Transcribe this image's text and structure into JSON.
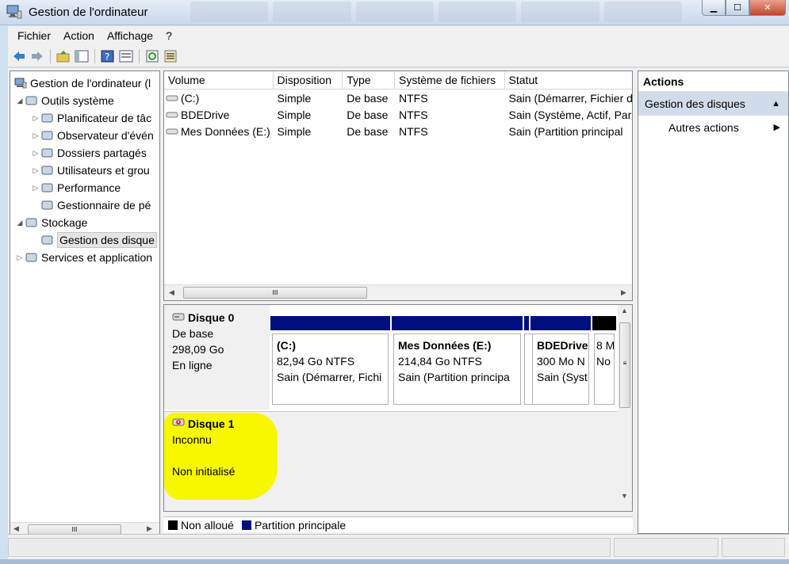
{
  "window": {
    "title": "Gestion de l'ordinateur",
    "controls": {
      "minimize": "▁",
      "maximize": "☐",
      "close": "✕"
    }
  },
  "menu": [
    "Fichier",
    "Action",
    "Affichage",
    "?"
  ],
  "tree": {
    "root": "Gestion de l'ordinateur (l",
    "items": [
      {
        "label": "Outils système",
        "level": 1,
        "expander": "◢",
        "icon": "tools-icon"
      },
      {
        "label": "Planificateur de tâc",
        "level": 2,
        "expander": "▷",
        "icon": "clock-icon"
      },
      {
        "label": "Observateur d'évén",
        "level": 2,
        "expander": "▷",
        "icon": "event-viewer-icon"
      },
      {
        "label": "Dossiers partagés",
        "level": 2,
        "expander": "▷",
        "icon": "shared-folder-icon"
      },
      {
        "label": "Utilisateurs et grou",
        "level": 2,
        "expander": "▷",
        "icon": "users-icon"
      },
      {
        "label": "Performance",
        "level": 2,
        "expander": "▷",
        "icon": "performance-icon"
      },
      {
        "label": "Gestionnaire de pé",
        "level": 2,
        "expander": "",
        "icon": "device-manager-icon"
      },
      {
        "label": "Stockage",
        "level": 1,
        "expander": "◢",
        "icon": "storage-icon"
      },
      {
        "label": "Gestion des disque",
        "level": 2,
        "expander": "",
        "icon": "disk-management-icon",
        "selected": true
      },
      {
        "label": "Services et application",
        "level": 1,
        "expander": "▷",
        "icon": "services-icon"
      }
    ],
    "scroll_thumb": "III"
  },
  "volumes": {
    "headers": [
      "Volume",
      "Disposition",
      "Type",
      "Système de fichiers",
      "Statut"
    ],
    "rows": [
      [
        "(C:)",
        "Simple",
        "De base",
        "NTFS",
        "Sain (Démarrer, Fichier d"
      ],
      [
        "BDEDrive",
        "Simple",
        "De base",
        "NTFS",
        "Sain (Système, Actif, Par"
      ],
      [
        "Mes Données (E:)",
        "Simple",
        "De base",
        "NTFS",
        "Sain (Partition principal"
      ]
    ],
    "scroll_thumb": "III"
  },
  "disks": [
    {
      "name": "Disque 0",
      "type": "De base",
      "size": "298,09 Go",
      "state": "En ligne",
      "partitions": [
        {
          "name": "(C:)",
          "size": "82,94 Go NTFS",
          "status": "Sain (Démarrer, Fichi",
          "band": "primary"
        },
        {
          "name": "Mes Données  (E:)",
          "size": "214,84 Go NTFS",
          "status": "Sain (Partition principa",
          "band": "primary"
        },
        {
          "name": "BDEDrive",
          "size": "300 Mo N",
          "status": "Sain (Syst",
          "band": "primary"
        },
        {
          "name": "",
          "size": "8 M",
          "status": "No",
          "band": "unallocated"
        }
      ]
    },
    {
      "name": "Disque 1",
      "type": "Inconnu",
      "state": "Non initialisé"
    }
  ],
  "legend": [
    {
      "label": "Non alloué",
      "color": "#000000"
    },
    {
      "label": "Partition principale",
      "color": "#000f80"
    }
  ],
  "actions": {
    "header": "Actions",
    "section": "Gestion des disques",
    "items": [
      "Autres actions"
    ]
  },
  "colors": {
    "highlight": "#f7f700",
    "partition_primary": "#000f80",
    "selection": "#d1dcea"
  }
}
